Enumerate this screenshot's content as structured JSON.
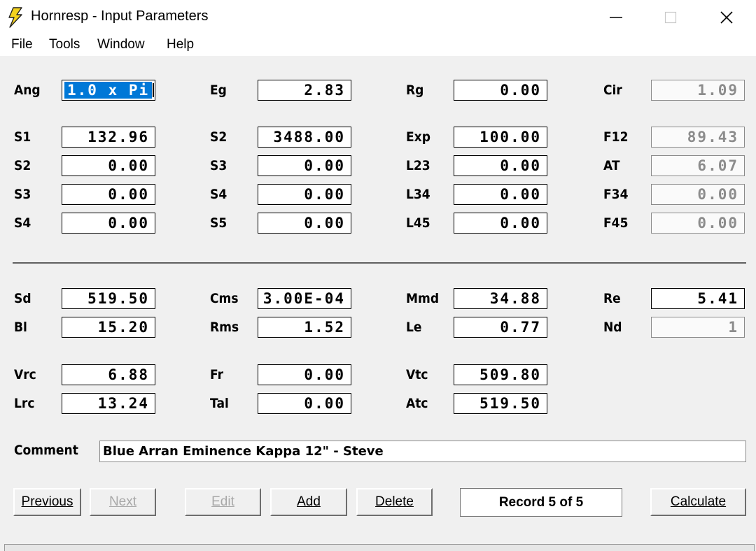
{
  "window": {
    "title": "Hornresp - Input Parameters"
  },
  "menu": [
    "File",
    "Tools",
    "Window",
    "Help"
  ],
  "params": [
    {
      "id": "ang",
      "label": "Ang",
      "value": "1.0 x Pi",
      "selected": true
    },
    {
      "id": "eg",
      "label": "Eg",
      "value": "2.83"
    },
    {
      "id": "rg",
      "label": "Rg",
      "value": "0.00"
    },
    {
      "id": "cir",
      "label": "Cir",
      "value": "1.09",
      "readonly": true
    },
    {
      "id": "s1",
      "label": "S1",
      "value": "132.96"
    },
    {
      "id": "s2-a",
      "label": "S2",
      "value": "3488.00"
    },
    {
      "id": "exp",
      "label": "Exp",
      "value": "100.00"
    },
    {
      "id": "f12",
      "label": "F12",
      "value": "89.43",
      "readonly": true
    },
    {
      "id": "s2-b",
      "label": "S2",
      "value": "0.00"
    },
    {
      "id": "s3-a",
      "label": "S3",
      "value": "0.00"
    },
    {
      "id": "l23",
      "label": "L23",
      "value": "0.00"
    },
    {
      "id": "at",
      "label": "AT",
      "value": "6.07",
      "readonly": true
    },
    {
      "id": "s3-b",
      "label": "S3",
      "value": "0.00"
    },
    {
      "id": "s4-a",
      "label": "S4",
      "value": "0.00"
    },
    {
      "id": "l34",
      "label": "L34",
      "value": "0.00"
    },
    {
      "id": "f34",
      "label": "F34",
      "value": "0.00",
      "readonly": true
    },
    {
      "id": "s4-b",
      "label": "S4",
      "value": "0.00"
    },
    {
      "id": "s5",
      "label": "S5",
      "value": "0.00"
    },
    {
      "id": "l45",
      "label": "L45",
      "value": "0.00"
    },
    {
      "id": "f45",
      "label": "F45",
      "value": "0.00",
      "readonly": true
    },
    {
      "id": "sd",
      "label": "Sd",
      "value": "519.50"
    },
    {
      "id": "cms",
      "label": "Cms",
      "value": "3.00E-04"
    },
    {
      "id": "mmd",
      "label": "Mmd",
      "value": "34.88"
    },
    {
      "id": "re",
      "label": "Re",
      "value": "5.41"
    },
    {
      "id": "bl",
      "label": "Bl",
      "value": "15.20"
    },
    {
      "id": "rms",
      "label": "Rms",
      "value": "1.52"
    },
    {
      "id": "le",
      "label": "Le",
      "value": "0.77"
    },
    {
      "id": "nd",
      "label": "Nd",
      "value": "1",
      "readonly": true
    },
    {
      "id": "vrc",
      "label": "Vrc",
      "value": "6.88"
    },
    {
      "id": "fr",
      "label": "Fr",
      "value": "0.00"
    },
    {
      "id": "vtc",
      "label": "Vtc",
      "value": "509.80"
    },
    {
      "id": "lrc",
      "label": "Lrc",
      "value": "13.24"
    },
    {
      "id": "tal",
      "label": "Tal",
      "value": "0.00"
    },
    {
      "id": "atc",
      "label": "Atc",
      "value": "519.50"
    }
  ],
  "comment": {
    "label": "Comment",
    "value": "Blue Arran Eminence Kappa 12\" - Steve"
  },
  "buttons": {
    "previous": "Previous",
    "next": "Next",
    "edit": "Edit",
    "add": "Add",
    "delete": "Delete",
    "calculate": "Calculate"
  },
  "record": "Record 5 of 5",
  "colors": {
    "selection": "#0078d7",
    "disabled_text": "#a8a8a8",
    "readonly_text": "#8c8c8c"
  }
}
